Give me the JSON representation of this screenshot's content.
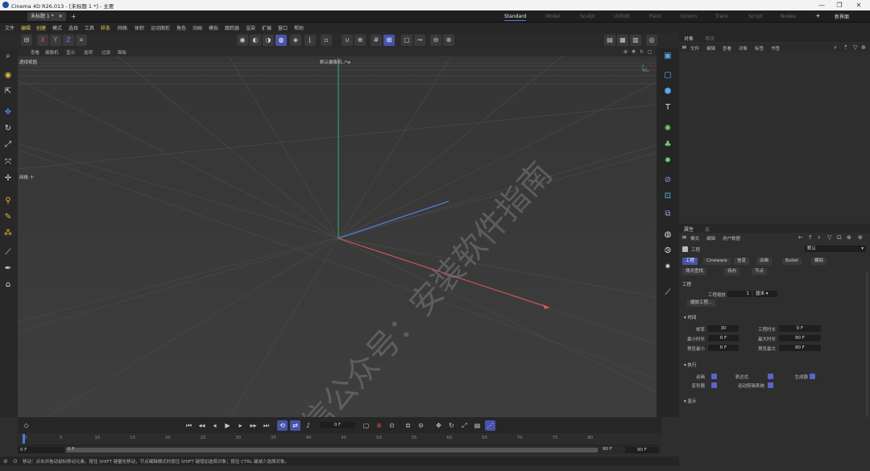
{
  "window": {
    "title": "Cinema 4D R26.013 - [未标题 1 *] - 主要",
    "minimize": "—",
    "maximize": "❐",
    "close": "✕"
  },
  "tabs": {
    "doc_tab": "未标题 1 *",
    "add_tab": "+",
    "layouts": [
      "Standard",
      "Model",
      "Sculpt",
      "UVEdit",
      "Paint",
      "Groom",
      "Track",
      "Script",
      "Nodes"
    ],
    "active_layout": "Standard",
    "new_interface": "新界面"
  },
  "menubar": [
    "文件",
    "编辑",
    "创建",
    "模式",
    "选择",
    "工具",
    "样条",
    "网格",
    "体积",
    "运动图形",
    "角色",
    "动画",
    "模拟",
    "跟踪器",
    "渲染",
    "扩展",
    "窗口",
    "帮助"
  ],
  "toolbar": {
    "axis_x": "X",
    "axis_y": "Y",
    "axis_z": "Z"
  },
  "viewport": {
    "menu": [
      "查看",
      "摄像机",
      "显示",
      "选项",
      "过滤",
      "面板"
    ],
    "label": "透视视图",
    "camera": "默认摄像机.:*≡",
    "side_label": "网格 十"
  },
  "object_panel": {
    "tabs": [
      "对象",
      "场次"
    ],
    "menu": [
      "文件",
      "编辑",
      "查看",
      "对象",
      "标签",
      "书签"
    ]
  },
  "attr_panel": {
    "tabs": [
      "属性",
      "层"
    ],
    "menu": [
      "模式",
      "编辑",
      "用户数据"
    ],
    "obj_name": "工程",
    "default_select": "默认",
    "subtabs": [
      "工程",
      "Cineware",
      "信息",
      "动画",
      "Bullet",
      "模拟"
    ],
    "subtabs2": [
      "场次查找",
      "待办",
      "节点"
    ],
    "section_project": "工程",
    "project_scale_label": "工程缩放",
    "project_scale_value": "1",
    "project_scale_unit": "厘米",
    "scale_button": "缩放工程...",
    "section_time": "时间",
    "fps_label": "帧率",
    "fps_value": "30",
    "project_time_label": "工程时长",
    "project_time_value": "0 F",
    "min_time_label": "最小时长",
    "min_time_value": "0 F",
    "max_time_label": "最大时长",
    "max_time_value": "90 F",
    "preview_min_label": "预览最小",
    "preview_min_value": "0 F",
    "preview_max_label": "预览最大",
    "preview_max_value": "90 F",
    "section_exec": "执行",
    "exec": [
      "动画",
      "表达式",
      "生成器",
      "变形器",
      "运动剪辑系统"
    ],
    "section_display": "显示"
  },
  "timeline": {
    "frame_value": "0 F",
    "ticks": [
      "0",
      "5",
      "10",
      "15",
      "20",
      "25",
      "30",
      "35",
      "40",
      "45",
      "50",
      "55",
      "60",
      "65",
      "70",
      "75",
      "80"
    ],
    "range_start": "0 F",
    "range_start2": "0 F",
    "range_end": "90 F",
    "range_end2": "90 F"
  },
  "status": {
    "text": "移动：点击并拖动鼠标移动元素。按住 SHIFT 键量化移动，节点编辑模式时按住 SHIFT 键增加选择对象；按住 CTRL 键减少选择对象。"
  },
  "watermark": "微信公众号：安装软件指南",
  "colors": {
    "accent": "#4654a8",
    "axis_x": "#e05555",
    "axis_y": "#2fb070",
    "axis_z": "#4a7ee0",
    "highlight_menu": "#e3c85a"
  }
}
